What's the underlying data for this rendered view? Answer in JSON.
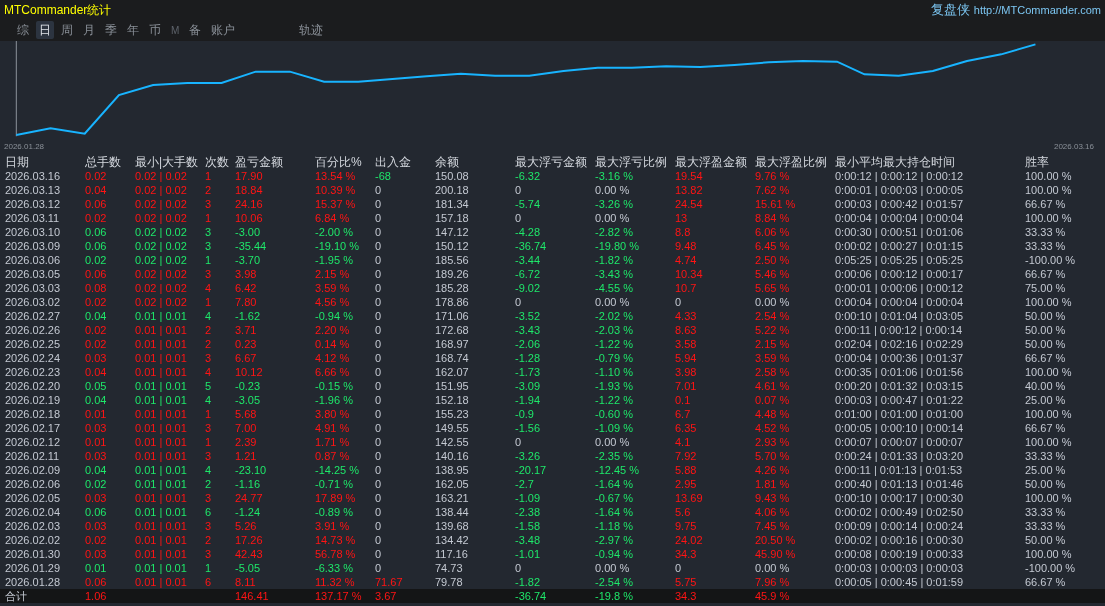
{
  "header": {
    "title": "MTCommander统计",
    "brand": "复盘侠",
    "link": "http://MTCommander.com"
  },
  "tabs": [
    {
      "label": "综",
      "selected": false,
      "disabled": false
    },
    {
      "label": "日",
      "selected": true,
      "disabled": false
    },
    {
      "label": "周",
      "selected": false,
      "disabled": false
    },
    {
      "label": "月",
      "selected": false,
      "disabled": false
    },
    {
      "label": "季",
      "selected": false,
      "disabled": false
    },
    {
      "label": "年",
      "selected": false,
      "disabled": false
    },
    {
      "label": "币",
      "selected": false,
      "disabled": false
    },
    {
      "label": "M",
      "selected": false,
      "disabled": true
    },
    {
      "label": "备",
      "selected": false,
      "disabled": false
    },
    {
      "label": "账户",
      "selected": false,
      "disabled": false
    }
  ],
  "track_tab": {
    "label": "轨迹",
    "selected": false
  },
  "chart": {
    "start_label": "2026.01.28",
    "end_label": "2026.03.16"
  },
  "table": {
    "columns": [
      "日期",
      "总手数",
      "最小|大手数",
      "次数",
      "盈亏金额",
      "百分比%",
      "出入金",
      "余额",
      "最大浮亏金额",
      "最大浮亏比例",
      "最大浮盈金额",
      "最大浮盈比例",
      "最小平均最大持仓时间",
      "胜率"
    ],
    "rows": [
      {
        "date": "2026.03.16",
        "lots": "0.02",
        "minmax": "0.02 | 0.02",
        "count": "1",
        "pl": "17.90",
        "pct": "13.54 %",
        "kind": "profit",
        "cash_flow": {
          "amount": "-68",
          "kind": "out"
        },
        "balance": "150.08",
        "float_loss": {
          "amount": "-6.32",
          "ratio": "-3.16 %",
          "kind": "loss"
        },
        "float_profit": {
          "amount": "19.54",
          "ratio": "9.76 %",
          "kind": "profit"
        },
        "times": "0:00:12 | 0:00:12 | 0:00:12",
        "win": "100.00 %"
      },
      {
        "date": "2026.03.13",
        "lots": "0.04",
        "minmax": "0.02 | 0.02",
        "count": "2",
        "pl": "18.84",
        "pct": "10.39 %",
        "kind": "profit",
        "cash_flow": {
          "amount": "0",
          "kind": "flat"
        },
        "balance": "200.18",
        "float_loss": {
          "amount": "0",
          "ratio": "0.00 %",
          "kind": "flat"
        },
        "float_profit": {
          "amount": "13.82",
          "ratio": "7.62 %",
          "kind": "profit"
        },
        "times": "0:00:01 | 0:00:03 | 0:00:05",
        "win": "100.00 %"
      },
      {
        "date": "2026.03.12",
        "lots": "0.06",
        "minmax": "0.02 | 0.02",
        "count": "3",
        "pl": "24.16",
        "pct": "15.37 %",
        "kind": "profit",
        "cash_flow": {
          "amount": "0",
          "kind": "flat"
        },
        "balance": "181.34",
        "float_loss": {
          "amount": "-5.74",
          "ratio": "-3.26 %",
          "kind": "loss"
        },
        "float_profit": {
          "amount": "24.54",
          "ratio": "15.61 %",
          "kind": "profit"
        },
        "times": "0:00:03 | 0:00:42 | 0:01:57",
        "win": "66.67 %"
      },
      {
        "date": "2026.03.11",
        "lots": "0.02",
        "minmax": "0.02 | 0.02",
        "count": "1",
        "pl": "10.06",
        "pct": "6.84 %",
        "kind": "profit",
        "cash_flow": {
          "amount": "0",
          "kind": "flat"
        },
        "balance": "157.18",
        "float_loss": {
          "amount": "0",
          "ratio": "0.00 %",
          "kind": "flat"
        },
        "float_profit": {
          "amount": "13",
          "ratio": "8.84 %",
          "kind": "profit"
        },
        "times": "0:00:04 | 0:00:04 | 0:00:04",
        "win": "100.00 %"
      },
      {
        "date": "2026.03.10",
        "lots": "0.06",
        "minmax": "0.02 | 0.02",
        "count": "3",
        "pl": "-3.00",
        "pct": "-2.00 %",
        "kind": "loss",
        "cash_flow": {
          "amount": "0",
          "kind": "flat"
        },
        "balance": "147.12",
        "float_loss": {
          "amount": "-4.28",
          "ratio": "-2.82 %",
          "kind": "loss"
        },
        "float_profit": {
          "amount": "8.8",
          "ratio": "6.06 %",
          "kind": "profit"
        },
        "times": "0:00:30 | 0:00:51 | 0:01:06",
        "win": "33.33 %"
      },
      {
        "date": "2026.03.09",
        "lots": "0.06",
        "minmax": "0.02 | 0.02",
        "count": "3",
        "pl": "-35.44",
        "pct": "-19.10 %",
        "kind": "loss",
        "cash_flow": {
          "amount": "0",
          "kind": "flat"
        },
        "balance": "150.12",
        "float_loss": {
          "amount": "-36.74",
          "ratio": "-19.80 %",
          "kind": "loss"
        },
        "float_profit": {
          "amount": "9.48",
          "ratio": "6.45 %",
          "kind": "profit"
        },
        "times": "0:00:02 | 0:00:27 | 0:01:15",
        "win": "33.33 %"
      },
      {
        "date": "2026.03.06",
        "lots": "0.02",
        "minmax": "0.02 | 0.02",
        "count": "1",
        "pl": "-3.70",
        "pct": "-1.95 %",
        "kind": "loss",
        "cash_flow": {
          "amount": "0",
          "kind": "flat"
        },
        "balance": "185.56",
        "float_loss": {
          "amount": "-3.44",
          "ratio": "-1.82 %",
          "kind": "loss"
        },
        "float_profit": {
          "amount": "4.74",
          "ratio": "2.50 %",
          "kind": "profit"
        },
        "times": "0:05:25 | 0:05:25 | 0:05:25",
        "win": "-100.00 %"
      },
      {
        "date": "2026.03.05",
        "lots": "0.06",
        "minmax": "0.02 | 0.02",
        "count": "3",
        "pl": "3.98",
        "pct": "2.15 %",
        "kind": "profit",
        "cash_flow": {
          "amount": "0",
          "kind": "flat"
        },
        "balance": "189.26",
        "float_loss": {
          "amount": "-6.72",
          "ratio": "-3.43 %",
          "kind": "loss"
        },
        "float_profit": {
          "amount": "10.34",
          "ratio": "5.46 %",
          "kind": "profit"
        },
        "times": "0:00:06 | 0:00:12 | 0:00:17",
        "win": "66.67 %"
      },
      {
        "date": "2026.03.03",
        "lots": "0.08",
        "minmax": "0.02 | 0.02",
        "count": "4",
        "pl": "6.42",
        "pct": "3.59 %",
        "kind": "profit",
        "cash_flow": {
          "amount": "0",
          "kind": "flat"
        },
        "balance": "185.28",
        "float_loss": {
          "amount": "-9.02",
          "ratio": "-4.55 %",
          "kind": "loss"
        },
        "float_profit": {
          "amount": "10.7",
          "ratio": "5.65 %",
          "kind": "profit"
        },
        "times": "0:00:01 | 0:00:06 | 0:00:12",
        "win": "75.00 %"
      },
      {
        "date": "2026.03.02",
        "lots": "0.02",
        "minmax": "0.02 | 0.02",
        "count": "1",
        "pl": "7.80",
        "pct": "4.56 %",
        "kind": "profit",
        "cash_flow": {
          "amount": "0",
          "kind": "flat"
        },
        "balance": "178.86",
        "float_loss": {
          "amount": "0",
          "ratio": "0.00 %",
          "kind": "flat"
        },
        "float_profit": {
          "amount": "0",
          "ratio": "0.00 %",
          "kind": "flat"
        },
        "times": "0:00:04 | 0:00:04 | 0:00:04",
        "win": "100.00 %"
      },
      {
        "date": "2026.02.27",
        "lots": "0.04",
        "minmax": "0.01 | 0.01",
        "count": "4",
        "pl": "-1.62",
        "pct": "-0.94 %",
        "kind": "loss",
        "cash_flow": {
          "amount": "0",
          "kind": "flat"
        },
        "balance": "171.06",
        "float_loss": {
          "amount": "-3.52",
          "ratio": "-2.02 %",
          "kind": "loss"
        },
        "float_profit": {
          "amount": "4.33",
          "ratio": "2.54 %",
          "kind": "profit"
        },
        "times": "0:00:10 | 0:01:04 | 0:03:05",
        "win": "50.00 %"
      },
      {
        "date": "2026.02.26",
        "lots": "0.02",
        "minmax": "0.01 | 0.01",
        "count": "2",
        "pl": "3.71",
        "pct": "2.20 %",
        "kind": "profit",
        "cash_flow": {
          "amount": "0",
          "kind": "flat"
        },
        "balance": "172.68",
        "float_loss": {
          "amount": "-3.43",
          "ratio": "-2.03 %",
          "kind": "loss"
        },
        "float_profit": {
          "amount": "8.63",
          "ratio": "5.22 %",
          "kind": "profit"
        },
        "times": "0:00:11 | 0:00:12 | 0:00:14",
        "win": "50.00 %"
      },
      {
        "date": "2026.02.25",
        "lots": "0.02",
        "minmax": "0.01 | 0.01",
        "count": "2",
        "pl": "0.23",
        "pct": "0.14 %",
        "kind": "profit",
        "cash_flow": {
          "amount": "0",
          "kind": "flat"
        },
        "balance": "168.97",
        "float_loss": {
          "amount": "-2.06",
          "ratio": "-1.22 %",
          "kind": "loss"
        },
        "float_profit": {
          "amount": "3.58",
          "ratio": "2.15 %",
          "kind": "profit"
        },
        "times": "0:02:04 | 0:02:16 | 0:02:29",
        "win": "50.00 %"
      },
      {
        "date": "2026.02.24",
        "lots": "0.03",
        "minmax": "0.01 | 0.01",
        "count": "3",
        "pl": "6.67",
        "pct": "4.12 %",
        "kind": "profit",
        "cash_flow": {
          "amount": "0",
          "kind": "flat"
        },
        "balance": "168.74",
        "float_loss": {
          "amount": "-1.28",
          "ratio": "-0.79 %",
          "kind": "loss"
        },
        "float_profit": {
          "amount": "5.94",
          "ratio": "3.59 %",
          "kind": "profit"
        },
        "times": "0:00:04 | 0:00:36 | 0:01:37",
        "win": "66.67 %"
      },
      {
        "date": "2026.02.23",
        "lots": "0.04",
        "minmax": "0.01 | 0.01",
        "count": "4",
        "pl": "10.12",
        "pct": "6.66 %",
        "kind": "profit",
        "cash_flow": {
          "amount": "0",
          "kind": "flat"
        },
        "balance": "162.07",
        "float_loss": {
          "amount": "-1.73",
          "ratio": "-1.10 %",
          "kind": "loss"
        },
        "float_profit": {
          "amount": "3.98",
          "ratio": "2.58 %",
          "kind": "profit"
        },
        "times": "0:00:35 | 0:01:06 | 0:01:56",
        "win": "100.00 %"
      },
      {
        "date": "2026.02.20",
        "lots": "0.05",
        "minmax": "0.01 | 0.01",
        "count": "5",
        "pl": "-0.23",
        "pct": "-0.15 %",
        "kind": "loss",
        "cash_flow": {
          "amount": "0",
          "kind": "flat"
        },
        "balance": "151.95",
        "float_loss": {
          "amount": "-3.09",
          "ratio": "-1.93 %",
          "kind": "loss"
        },
        "float_profit": {
          "amount": "7.01",
          "ratio": "4.61 %",
          "kind": "profit"
        },
        "times": "0:00:20 | 0:01:32 | 0:03:15",
        "win": "40.00 %"
      },
      {
        "date": "2026.02.19",
        "lots": "0.04",
        "minmax": "0.01 | 0.01",
        "count": "4",
        "pl": "-3.05",
        "pct": "-1.96 %",
        "kind": "loss",
        "cash_flow": {
          "amount": "0",
          "kind": "flat"
        },
        "balance": "152.18",
        "float_loss": {
          "amount": "-1.94",
          "ratio": "-1.22 %",
          "kind": "loss"
        },
        "float_profit": {
          "amount": "0.1",
          "ratio": "0.07 %",
          "kind": "profit"
        },
        "times": "0:00:03 | 0:00:47 | 0:01:22",
        "win": "25.00 %"
      },
      {
        "date": "2026.02.18",
        "lots": "0.01",
        "minmax": "0.01 | 0.01",
        "count": "1",
        "pl": "5.68",
        "pct": "3.80 %",
        "kind": "profit",
        "cash_flow": {
          "amount": "0",
          "kind": "flat"
        },
        "balance": "155.23",
        "float_loss": {
          "amount": "-0.9",
          "ratio": "-0.60 %",
          "kind": "loss"
        },
        "float_profit": {
          "amount": "6.7",
          "ratio": "4.48 %",
          "kind": "profit"
        },
        "times": "0:01:00 | 0:01:00 | 0:01:00",
        "win": "100.00 %"
      },
      {
        "date": "2026.02.17",
        "lots": "0.03",
        "minmax": "0.01 | 0.01",
        "count": "3",
        "pl": "7.00",
        "pct": "4.91 %",
        "kind": "profit",
        "cash_flow": {
          "amount": "0",
          "kind": "flat"
        },
        "balance": "149.55",
        "float_loss": {
          "amount": "-1.56",
          "ratio": "-1.09 %",
          "kind": "loss"
        },
        "float_profit": {
          "amount": "6.35",
          "ratio": "4.52 %",
          "kind": "profit"
        },
        "times": "0:00:05 | 0:00:10 | 0:00:14",
        "win": "66.67 %"
      },
      {
        "date": "2026.02.12",
        "lots": "0.01",
        "minmax": "0.01 | 0.01",
        "count": "1",
        "pl": "2.39",
        "pct": "1.71 %",
        "kind": "profit",
        "cash_flow": {
          "amount": "0",
          "kind": "flat"
        },
        "balance": "142.55",
        "float_loss": {
          "amount": "0",
          "ratio": "0.00 %",
          "kind": "flat"
        },
        "float_profit": {
          "amount": "4.1",
          "ratio": "2.93 %",
          "kind": "profit"
        },
        "times": "0:00:07 | 0:00:07 | 0:00:07",
        "win": "100.00 %"
      },
      {
        "date": "2026.02.11",
        "lots": "0.03",
        "minmax": "0.01 | 0.01",
        "count": "3",
        "pl": "1.21",
        "pct": "0.87 %",
        "kind": "profit",
        "cash_flow": {
          "amount": "0",
          "kind": "flat"
        },
        "balance": "140.16",
        "float_loss": {
          "amount": "-3.26",
          "ratio": "-2.35 %",
          "kind": "loss"
        },
        "float_profit": {
          "amount": "7.92",
          "ratio": "5.70 %",
          "kind": "profit"
        },
        "times": "0:00:24 | 0:01:33 | 0:03:20",
        "win": "33.33 %"
      },
      {
        "date": "2026.02.09",
        "lots": "0.04",
        "minmax": "0.01 | 0.01",
        "count": "4",
        "pl": "-23.10",
        "pct": "-14.25 %",
        "kind": "loss",
        "cash_flow": {
          "amount": "0",
          "kind": "flat"
        },
        "balance": "138.95",
        "float_loss": {
          "amount": "-20.17",
          "ratio": "-12.45 %",
          "kind": "loss"
        },
        "float_profit": {
          "amount": "5.88",
          "ratio": "4.26 %",
          "kind": "profit"
        },
        "times": "0:00:11 | 0:01:13 | 0:01:53",
        "win": "25.00 %"
      },
      {
        "date": "2026.02.06",
        "lots": "0.02",
        "minmax": "0.01 | 0.01",
        "count": "2",
        "pl": "-1.16",
        "pct": "-0.71 %",
        "kind": "loss",
        "cash_flow": {
          "amount": "0",
          "kind": "flat"
        },
        "balance": "162.05",
        "float_loss": {
          "amount": "-2.7",
          "ratio": "-1.64 %",
          "kind": "loss"
        },
        "float_profit": {
          "amount": "2.95",
          "ratio": "1.81 %",
          "kind": "profit"
        },
        "times": "0:00:40 | 0:01:13 | 0:01:46",
        "win": "50.00 %"
      },
      {
        "date": "2026.02.05",
        "lots": "0.03",
        "minmax": "0.01 | 0.01",
        "count": "3",
        "pl": "24.77",
        "pct": "17.89 %",
        "kind": "profit",
        "cash_flow": {
          "amount": "0",
          "kind": "flat"
        },
        "balance": "163.21",
        "float_loss": {
          "amount": "-1.09",
          "ratio": "-0.67 %",
          "kind": "loss"
        },
        "float_profit": {
          "amount": "13.69",
          "ratio": "9.43 %",
          "kind": "profit"
        },
        "times": "0:00:10 | 0:00:17 | 0:00:30",
        "win": "100.00 %"
      },
      {
        "date": "2026.02.04",
        "lots": "0.06",
        "minmax": "0.01 | 0.01",
        "count": "6",
        "pl": "-1.24",
        "pct": "-0.89 %",
        "kind": "loss",
        "cash_flow": {
          "amount": "0",
          "kind": "flat"
        },
        "balance": "138.44",
        "float_loss": {
          "amount": "-2.38",
          "ratio": "-1.64 %",
          "kind": "loss"
        },
        "float_profit": {
          "amount": "5.6",
          "ratio": "4.06 %",
          "kind": "profit"
        },
        "times": "0:00:02 | 0:00:49 | 0:02:50",
        "win": "33.33 %"
      },
      {
        "date": "2026.02.03",
        "lots": "0.03",
        "minmax": "0.01 | 0.01",
        "count": "3",
        "pl": "5.26",
        "pct": "3.91 %",
        "kind": "profit",
        "cash_flow": {
          "amount": "0",
          "kind": "flat"
        },
        "balance": "139.68",
        "float_loss": {
          "amount": "-1.58",
          "ratio": "-1.18 %",
          "kind": "loss"
        },
        "float_profit": {
          "amount": "9.75",
          "ratio": "7.45 %",
          "kind": "profit"
        },
        "times": "0:00:09 | 0:00:14 | 0:00:24",
        "win": "33.33 %"
      },
      {
        "date": "2026.02.02",
        "lots": "0.02",
        "minmax": "0.01 | 0.01",
        "count": "2",
        "pl": "17.26",
        "pct": "14.73 %",
        "kind": "profit",
        "cash_flow": {
          "amount": "0",
          "kind": "flat"
        },
        "balance": "134.42",
        "float_loss": {
          "amount": "-3.48",
          "ratio": "-2.97 %",
          "kind": "loss"
        },
        "float_profit": {
          "amount": "24.02",
          "ratio": "20.50 %",
          "kind": "profit"
        },
        "times": "0:00:02 | 0:00:16 | 0:00:30",
        "win": "50.00 %"
      },
      {
        "date": "2026.01.30",
        "lots": "0.03",
        "minmax": "0.01 | 0.01",
        "count": "3",
        "pl": "42.43",
        "pct": "56.78 %",
        "kind": "profit",
        "cash_flow": {
          "amount": "0",
          "kind": "flat"
        },
        "balance": "117.16",
        "float_loss": {
          "amount": "-1.01",
          "ratio": "-0.94 %",
          "kind": "loss"
        },
        "float_profit": {
          "amount": "34.3",
          "ratio": "45.90 %",
          "kind": "profit"
        },
        "times": "0:00:08 | 0:00:19 | 0:00:33",
        "win": "100.00 %"
      },
      {
        "date": "2026.01.29",
        "lots": "0.01",
        "minmax": "0.01 | 0.01",
        "count": "1",
        "pl": "-5.05",
        "pct": "-6.33 %",
        "kind": "loss",
        "cash_flow": {
          "amount": "0",
          "kind": "flat"
        },
        "balance": "74.73",
        "float_loss": {
          "amount": "0",
          "ratio": "0.00 %",
          "kind": "flat"
        },
        "float_profit": {
          "amount": "0",
          "ratio": "0.00 %",
          "kind": "flat"
        },
        "times": "0:00:03 | 0:00:03 | 0:00:03",
        "win": "-100.00 %"
      },
      {
        "date": "2026.01.28",
        "lots": "0.06",
        "minmax": "0.01 | 0.01",
        "count": "6",
        "pl": "8.11",
        "pct": "11.32 %",
        "kind": "profit",
        "cash_flow": {
          "amount": "71.67",
          "kind": "in"
        },
        "balance": "79.78",
        "float_loss": {
          "amount": "-1.82",
          "ratio": "-2.54 %",
          "kind": "loss"
        },
        "float_profit": {
          "amount": "5.75",
          "ratio": "7.96 %",
          "kind": "profit"
        },
        "times": "0:00:05 | 0:00:45 | 0:01:59",
        "win": "66.67 %"
      }
    ],
    "total": {
      "label": "合计",
      "lots": "1.06",
      "pl": "146.41",
      "pct": "137.17 %",
      "kind": "profit",
      "cash_flow": {
        "amount": "3.67",
        "kind": "in"
      },
      "float_loss": {
        "amount": "-36.74",
        "ratio": "-19.8 %",
        "kind": "loss"
      },
      "float_profit": {
        "amount": "34.3",
        "ratio": "45.9 %",
        "kind": "profit"
      }
    }
  }
}
